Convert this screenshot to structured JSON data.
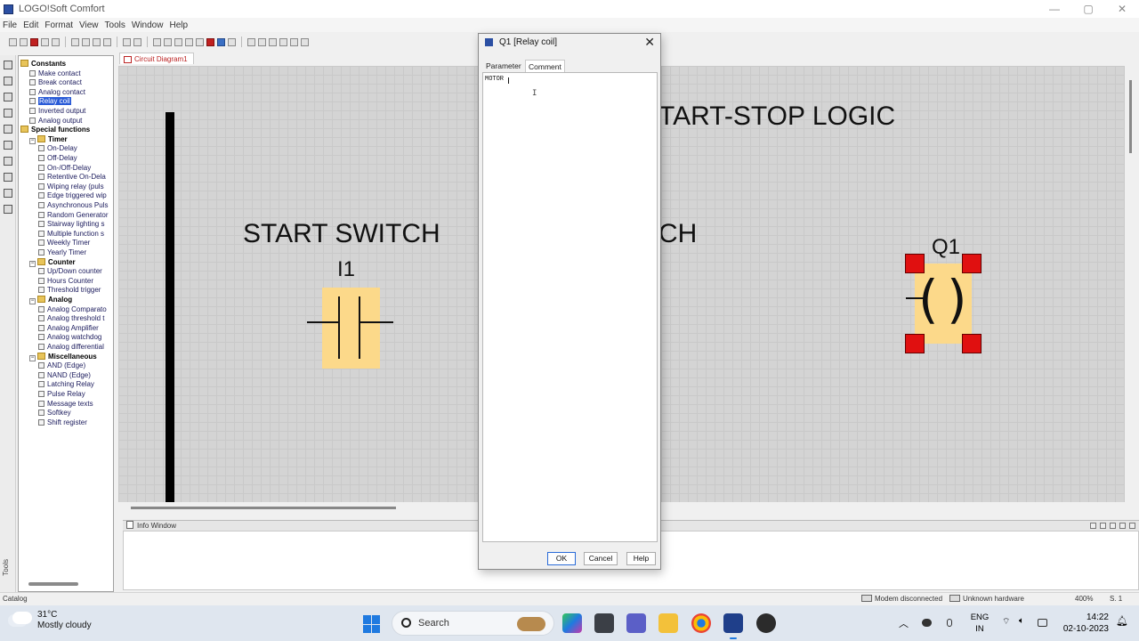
{
  "app": {
    "title": "LOGO!Soft Comfort",
    "win_controls": [
      "—",
      "▢",
      "✕"
    ]
  },
  "menu": [
    "File",
    "Edit",
    "Format",
    "View",
    "Tools",
    "Window",
    "Help"
  ],
  "catalog": {
    "items": [
      {
        "label": "Constants",
        "type": "folder",
        "level": 0
      },
      {
        "label": "Make contact",
        "type": "leaf",
        "level": 1
      },
      {
        "label": "Break contact",
        "type": "leaf",
        "level": 1
      },
      {
        "label": "Analog contact",
        "type": "leaf",
        "level": 1
      },
      {
        "label": "Relay coil",
        "type": "leaf",
        "level": 1,
        "selected": true
      },
      {
        "label": "Inverted output",
        "type": "leaf",
        "level": 1
      },
      {
        "label": "Analog output",
        "type": "leaf",
        "level": 1
      },
      {
        "label": "Special functions",
        "type": "folder",
        "level": 0
      },
      {
        "label": "Timer",
        "type": "folder",
        "level": 1
      },
      {
        "label": "On-Delay",
        "type": "leaf",
        "level": 2
      },
      {
        "label": "Off-Delay",
        "type": "leaf",
        "level": 2
      },
      {
        "label": "On-/Off-Delay",
        "type": "leaf",
        "level": 2
      },
      {
        "label": "Retentive On-Dela",
        "type": "leaf",
        "level": 2
      },
      {
        "label": "Wiping relay (puls",
        "type": "leaf",
        "level": 2
      },
      {
        "label": "Edge triggered wip",
        "type": "leaf",
        "level": 2
      },
      {
        "label": "Asynchronous Puls",
        "type": "leaf",
        "level": 2
      },
      {
        "label": "Random Generator",
        "type": "leaf",
        "level": 2
      },
      {
        "label": "Stairway lighting s",
        "type": "leaf",
        "level": 2
      },
      {
        "label": "Multiple function s",
        "type": "leaf",
        "level": 2
      },
      {
        "label": "Weekly Timer",
        "type": "leaf",
        "level": 2
      },
      {
        "label": "Yearly Timer",
        "type": "leaf",
        "level": 2
      },
      {
        "label": "Counter",
        "type": "folder",
        "level": 1
      },
      {
        "label": "Up/Down counter",
        "type": "leaf",
        "level": 2
      },
      {
        "label": "Hours Counter",
        "type": "leaf",
        "level": 2
      },
      {
        "label": "Threshold trigger",
        "type": "leaf",
        "level": 2
      },
      {
        "label": "Analog",
        "type": "folder",
        "level": 1
      },
      {
        "label": "Analog Comparato",
        "type": "leaf",
        "level": 2
      },
      {
        "label": "Analog threshold t",
        "type": "leaf",
        "level": 2
      },
      {
        "label": "Analog Amplifier",
        "type": "leaf",
        "level": 2
      },
      {
        "label": "Analog watchdog",
        "type": "leaf",
        "level": 2
      },
      {
        "label": "Analog differential",
        "type": "leaf",
        "level": 2
      },
      {
        "label": "Miscellaneous",
        "type": "folder",
        "level": 1
      },
      {
        "label": "AND (Edge)",
        "type": "leaf",
        "level": 2
      },
      {
        "label": "NAND (Edge)",
        "type": "leaf",
        "level": 2
      },
      {
        "label": "Latching Relay",
        "type": "leaf",
        "level": 2
      },
      {
        "label": "Pulse Relay",
        "type": "leaf",
        "level": 2
      },
      {
        "label": "Message texts",
        "type": "leaf",
        "level": 2
      },
      {
        "label": "Softkey",
        "type": "leaf",
        "level": 2
      },
      {
        "label": "Shift register",
        "type": "leaf",
        "level": 2
      }
    ]
  },
  "toolstrip_label": "Tools",
  "document": {
    "tab": "Circuit Diagram1",
    "heading": "TART-STOP LOGIC",
    "start_label": "START SWITCH",
    "partial_label": "CH",
    "contact_id": "I1",
    "coil_id": "Q1"
  },
  "info_window": {
    "title": "Info Window"
  },
  "dialog": {
    "title": "Q1 [Relay coil]",
    "tabs": [
      "Parameter",
      "Comment"
    ],
    "active_tab": "Comment",
    "comment_value": "MOTOR",
    "ok": "OK",
    "cancel": "Cancel",
    "help": "Help"
  },
  "status": {
    "left": "Catalog",
    "modem": "Modem disconnected",
    "hardware": "Unknown hardware",
    "zoom": "400%",
    "page": "S. 1"
  },
  "taskbar": {
    "temperature": "31°C",
    "weather": "Mostly cloudy",
    "search": "Search",
    "lang_top": "ENG",
    "lang_bottom": "IN",
    "time": "14:22",
    "date": "02-10-2023"
  },
  "colors": {
    "block_fill": "#fcd98a",
    "handle": "#e01010",
    "selection": "#2a5bd7",
    "accent": "#1f7ae0"
  }
}
